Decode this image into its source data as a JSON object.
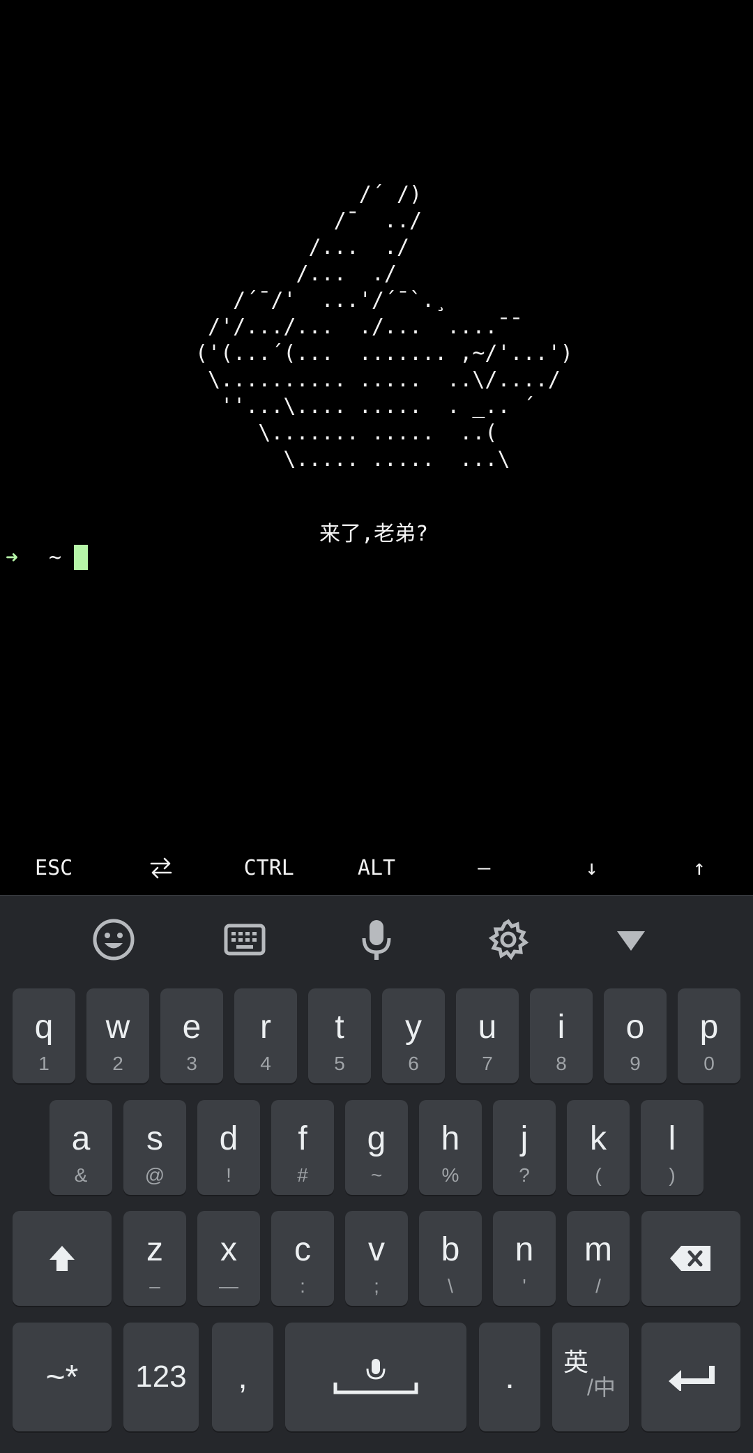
{
  "terminal": {
    "ascii_art": "             /´ /)\n           /¯  ../\n         /...  ./\n        /...  ./\n   /´¯/'  ...'/´¯`.¸\n /'/.../...  ./...  ....¯¯\n('(...´(...  ....... ,~/'...')\n \\.......... .....  ..\\/..../\n  ''...\\.... .....  . _.. ´\n     \\....... .....  ..(\n       \\..... .....  ...\\",
    "greeting": "来了,老弟?",
    "prompt_arrow": "➜",
    "prompt_dir": "~"
  },
  "extra_keys": {
    "esc": "ESC",
    "ctrl": "CTRL",
    "alt": "ALT",
    "dash": "—",
    "down": "↓",
    "up": "↑"
  },
  "keyboard": {
    "row1": [
      {
        "main": "q",
        "sub": "1"
      },
      {
        "main": "w",
        "sub": "2"
      },
      {
        "main": "e",
        "sub": "3"
      },
      {
        "main": "r",
        "sub": "4"
      },
      {
        "main": "t",
        "sub": "5"
      },
      {
        "main": "y",
        "sub": "6"
      },
      {
        "main": "u",
        "sub": "7"
      },
      {
        "main": "i",
        "sub": "8"
      },
      {
        "main": "o",
        "sub": "9"
      },
      {
        "main": "p",
        "sub": "0"
      }
    ],
    "row2": [
      {
        "main": "a",
        "sub": "&"
      },
      {
        "main": "s",
        "sub": "@"
      },
      {
        "main": "d",
        "sub": "!"
      },
      {
        "main": "f",
        "sub": "#"
      },
      {
        "main": "g",
        "sub": "~"
      },
      {
        "main": "h",
        "sub": "%"
      },
      {
        "main": "j",
        "sub": "?"
      },
      {
        "main": "k",
        "sub": "("
      },
      {
        "main": "l",
        "sub": ")"
      }
    ],
    "row3": [
      {
        "main": "z",
        "sub": "–"
      },
      {
        "main": "x",
        "sub": "—"
      },
      {
        "main": "c",
        "sub": ":"
      },
      {
        "main": "v",
        "sub": ";"
      },
      {
        "main": "b",
        "sub": "\\"
      },
      {
        "main": "n",
        "sub": "'"
      },
      {
        "main": "m",
        "sub": "/"
      }
    ],
    "symbols_key": "~*",
    "numbers_key": "123",
    "comma_key": ",",
    "period_key": ".",
    "lang_key_main": "英",
    "lang_key_sub": "/中"
  },
  "colors": {
    "terminal_bg": "#000000",
    "prompt_green": "#b6f5a8",
    "keyboard_bg": "#25272b",
    "key_bg": "#3c3f44"
  }
}
